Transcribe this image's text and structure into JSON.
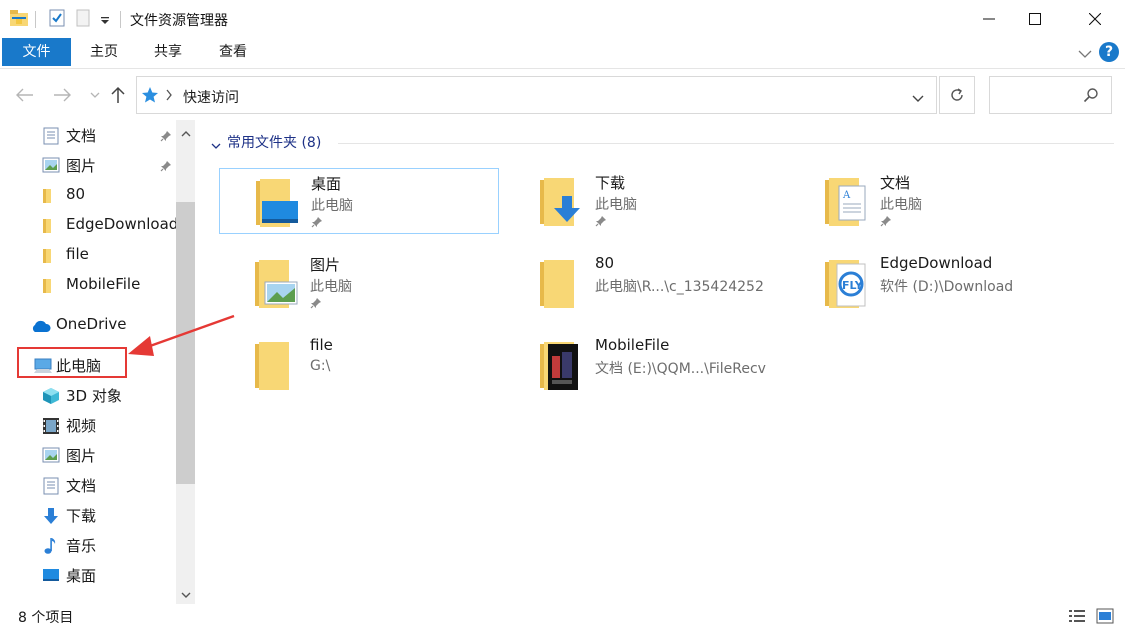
{
  "window": {
    "title": "文件资源管理器"
  },
  "ribbon": {
    "tabs": [
      "文件",
      "主页",
      "共享",
      "查看"
    ]
  },
  "address": {
    "crumb": "快速访问"
  },
  "sidebar": {
    "items": [
      {
        "label": "文档",
        "icon": "documents-icon",
        "pinned": true
      },
      {
        "label": "图片",
        "icon": "pictures-icon",
        "pinned": true
      },
      {
        "label": "80",
        "icon": "folder-icon",
        "pinned": false
      },
      {
        "label": "EdgeDownload",
        "icon": "folder-icon",
        "pinned": false
      },
      {
        "label": "file",
        "icon": "folder-icon",
        "pinned": false
      },
      {
        "label": "MobileFile",
        "icon": "folder-icon",
        "pinned": false
      },
      {
        "label": "OneDrive",
        "icon": "onedrive-icon",
        "pinned": false
      },
      {
        "label": "此电脑",
        "icon": "this-pc-icon",
        "pinned": false
      },
      {
        "label": "3D 对象",
        "icon": "3d-objects-icon",
        "pinned": false
      },
      {
        "label": "视频",
        "icon": "videos-icon",
        "pinned": false
      },
      {
        "label": "图片",
        "icon": "pictures-icon",
        "pinned": false
      },
      {
        "label": "文档",
        "icon": "documents-icon",
        "pinned": false
      },
      {
        "label": "下载",
        "icon": "downloads-icon",
        "pinned": false
      },
      {
        "label": "音乐",
        "icon": "music-icon",
        "pinned": false
      },
      {
        "label": "桌面",
        "icon": "desktop-icon",
        "pinned": false
      }
    ]
  },
  "main": {
    "group_title": "常用文件夹 (8)",
    "folders": [
      {
        "name": "桌面",
        "location": "此电脑",
        "pinned": true
      },
      {
        "name": "下载",
        "location": "此电脑",
        "pinned": true
      },
      {
        "name": "文档",
        "location": "此电脑",
        "pinned": true
      },
      {
        "name": "图片",
        "location": "此电脑",
        "pinned": true
      },
      {
        "name": "80",
        "location": "此电脑\\R...\\c_135424252",
        "pinned": false
      },
      {
        "name": "EdgeDownload",
        "location": "软件 (D:)\\Download",
        "pinned": false
      },
      {
        "name": "file",
        "location": "G:\\",
        "pinned": false
      },
      {
        "name": "MobileFile",
        "location": "文档 (E:)\\QQM...\\FileRecv",
        "pinned": false
      }
    ]
  },
  "status": {
    "count": "8 个项目"
  },
  "colors": {
    "accent": "#1979ca",
    "folder": "#f8d775",
    "highlight": "#e53935",
    "group_title": "#1e3287"
  }
}
